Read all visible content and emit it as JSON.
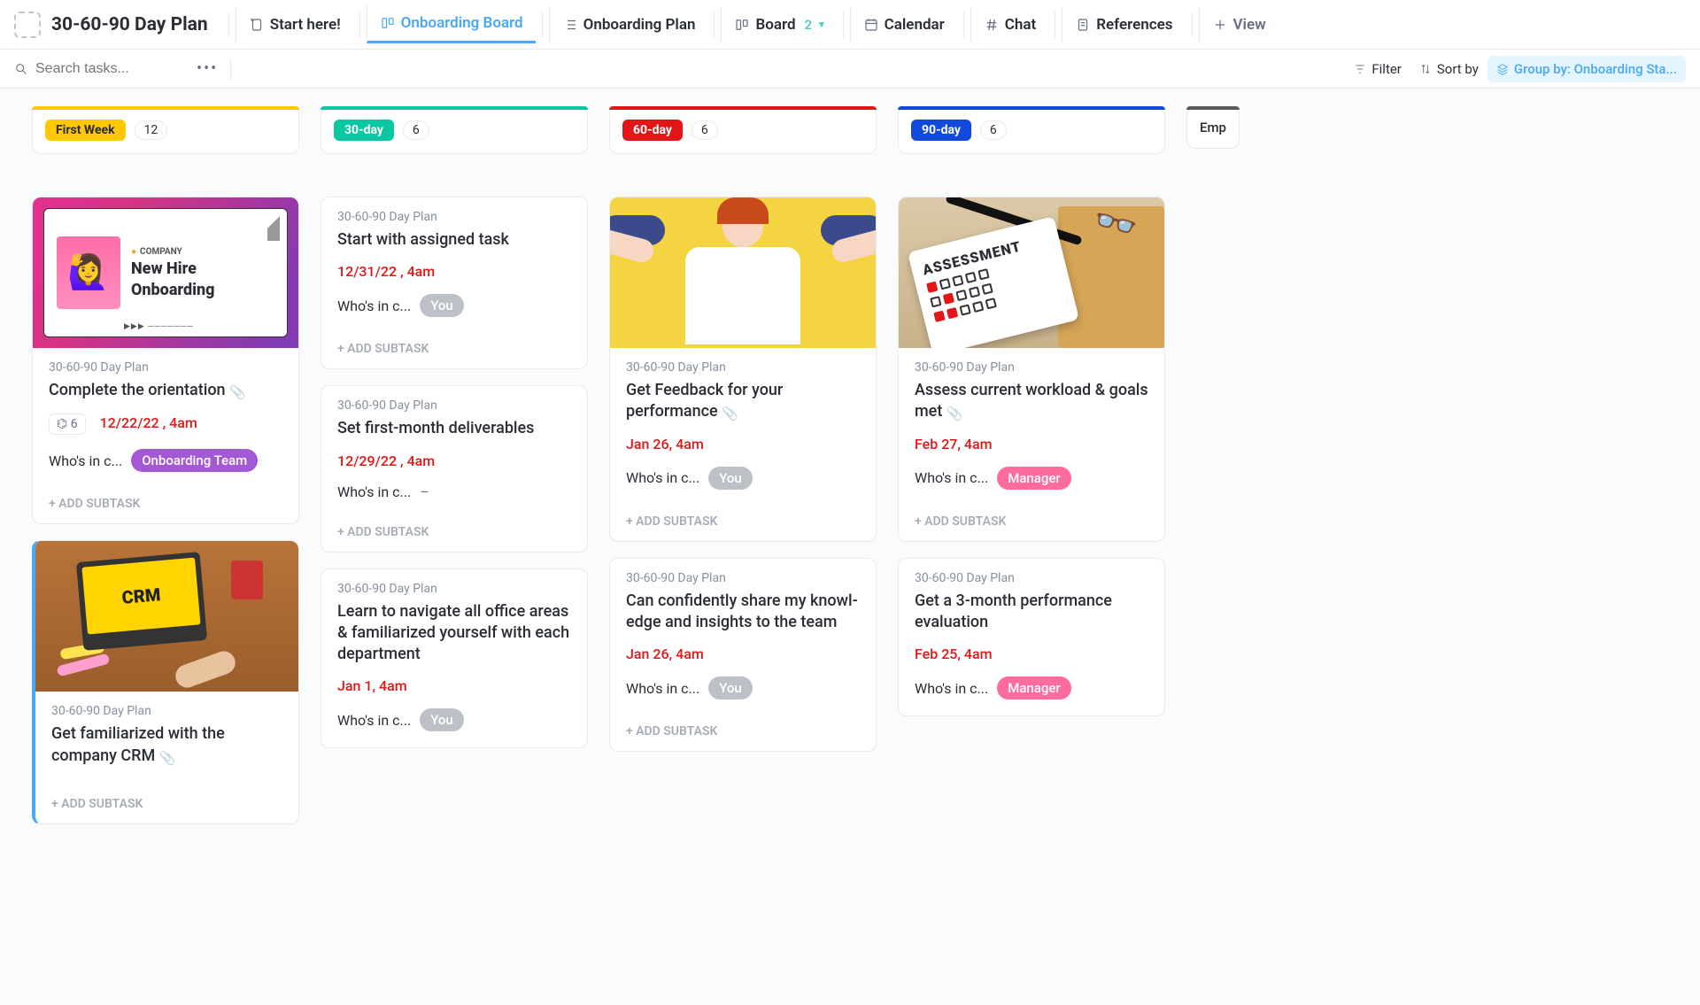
{
  "header": {
    "page_title": "30-60-90 Day Plan",
    "tabs": [
      {
        "label": "Start here!"
      },
      {
        "label": "Onboarding Board"
      },
      {
        "label": "Onboarding Plan"
      },
      {
        "label": "Board",
        "count": "2"
      },
      {
        "label": "Calendar"
      },
      {
        "label": "Chat"
      },
      {
        "label": "References"
      }
    ],
    "add_view": "View"
  },
  "toolbar": {
    "search_placeholder": "Search tasks...",
    "filter": "Filter",
    "sort": "Sort by",
    "group_by": "Group by: Onboarding Sta..."
  },
  "project_label": "30-60-90 Day Plan",
  "who_label": "Who's in c...",
  "add_subtask": "+ ADD SUBTASK",
  "assignees": {
    "you": "You",
    "team": "Onboarding Team",
    "manager": "Manager",
    "dash": "–"
  },
  "hero": {
    "brand": "COMPANY",
    "line1": "New Hire",
    "line2": "Onboarding",
    "play": "▶▶▶"
  },
  "crm_label": "CRM",
  "assessment_label": "ASSESSMENT",
  "columns": [
    {
      "key": "first",
      "label": "First Week",
      "count": "12",
      "cards": [
        {
          "title": "Complete the orientation",
          "clip": true,
          "subtasks": "6",
          "due": "12/22/22 , 4am",
          "assignee": "team",
          "cover": "hero"
        },
        {
          "title": "Get familiarized with the company CRM",
          "clip": true,
          "cover": "crm",
          "active": true
        }
      ]
    },
    {
      "key": "30",
      "label": "30-day",
      "count": "6",
      "cards": [
        {
          "title": "Start with assigned task",
          "due": "12/31/22 , 4am",
          "assignee": "you"
        },
        {
          "title": "Set first-month deliverables",
          "due": "12/29/22 , 4am",
          "assignee": "dash"
        },
        {
          "title": "Learn to navigate all office areas & familiarized yourself with each de­partment",
          "due": "Jan 1, 4am",
          "assignee": "you",
          "hideAddSub": true
        }
      ]
    },
    {
      "key": "60",
      "label": "60-day",
      "count": "6",
      "cards": [
        {
          "title": "Get Feedback for your performance",
          "clip": true,
          "due": "Jan 26, 4am",
          "assignee": "you",
          "cover": "feedback"
        },
        {
          "title": "Can confidently share my knowl­edge and insights to the team",
          "due": "Jan 26, 4am",
          "assignee": "you"
        }
      ]
    },
    {
      "key": "90",
      "label": "90-day",
      "count": "6",
      "cards": [
        {
          "title": "Assess current workload & goals met",
          "clip": true,
          "due": "Feb 27, 4am",
          "assignee": "manager",
          "cover": "assess"
        },
        {
          "title": "Get a 3-month performance evalua­tion",
          "due": "Feb 25, 4am",
          "assignee": "manager",
          "hideAddSub": true
        }
      ]
    },
    {
      "key": "emp",
      "label": "Emp",
      "cards": []
    }
  ]
}
